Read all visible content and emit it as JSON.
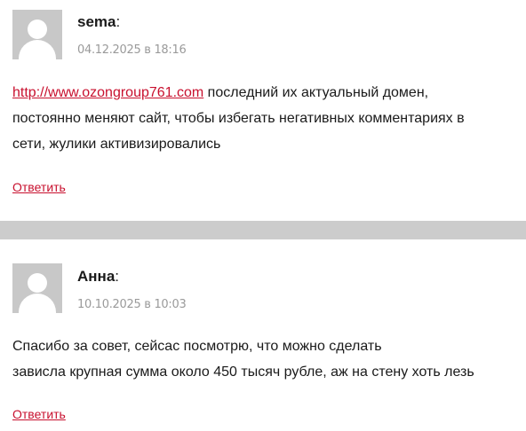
{
  "comments": [
    {
      "author": "sema",
      "colon": ":",
      "date": "04.12.2025 в 18:16",
      "link": "http://www.ozongroup761.com",
      "text_line1": " последний их актуальный домен,",
      "text_line2": "постоянно меняют сайт, чтобы избегать негативных комментариях в",
      "text_line3": "сети, жулики активизировались",
      "reply": "Ответить"
    },
    {
      "author": "Анна",
      "colon": ":",
      "date": "10.10.2025 в 10:03",
      "text_line1": "Спасибо за совет, сейсас посмотрю, что можно сделать",
      "text_line2": "зависла крупная сумма около 450 тысяч рубле, аж на стену хоть лезь",
      "reply": "Ответить"
    }
  ],
  "colors": {
    "link": "#c8102e",
    "meta": "#9a9a9a",
    "separator": "#cccccc",
    "avatar_bg": "#c8c8c8"
  },
  "icons": {
    "avatar": "user-avatar-placeholder-icon"
  }
}
